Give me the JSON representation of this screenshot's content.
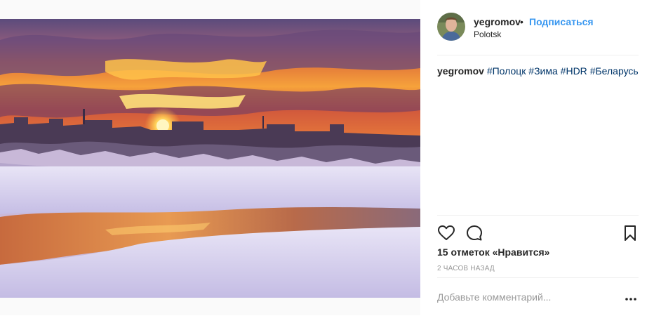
{
  "post": {
    "username": "yegromov",
    "separator": "•",
    "follow_label": "Подписаться",
    "location": "Polotsk",
    "caption_user": "yegromov",
    "hashtags": [
      "#Полоцк",
      "#Зима",
      "#HDR",
      "#Беларусь"
    ],
    "likes_text": "15 отметок «Нравится»",
    "time_text": "2 ЧАСОВ НАЗАД",
    "comment_placeholder": "Добавьте комментарий..."
  },
  "icons": {
    "like": "heart-icon",
    "comment": "comment-icon",
    "save": "bookmark-icon",
    "more": "more-options-icon"
  },
  "colors": {
    "link": "#3897f0",
    "hashtag": "#003569",
    "meta": "#999999",
    "text": "#262626"
  }
}
